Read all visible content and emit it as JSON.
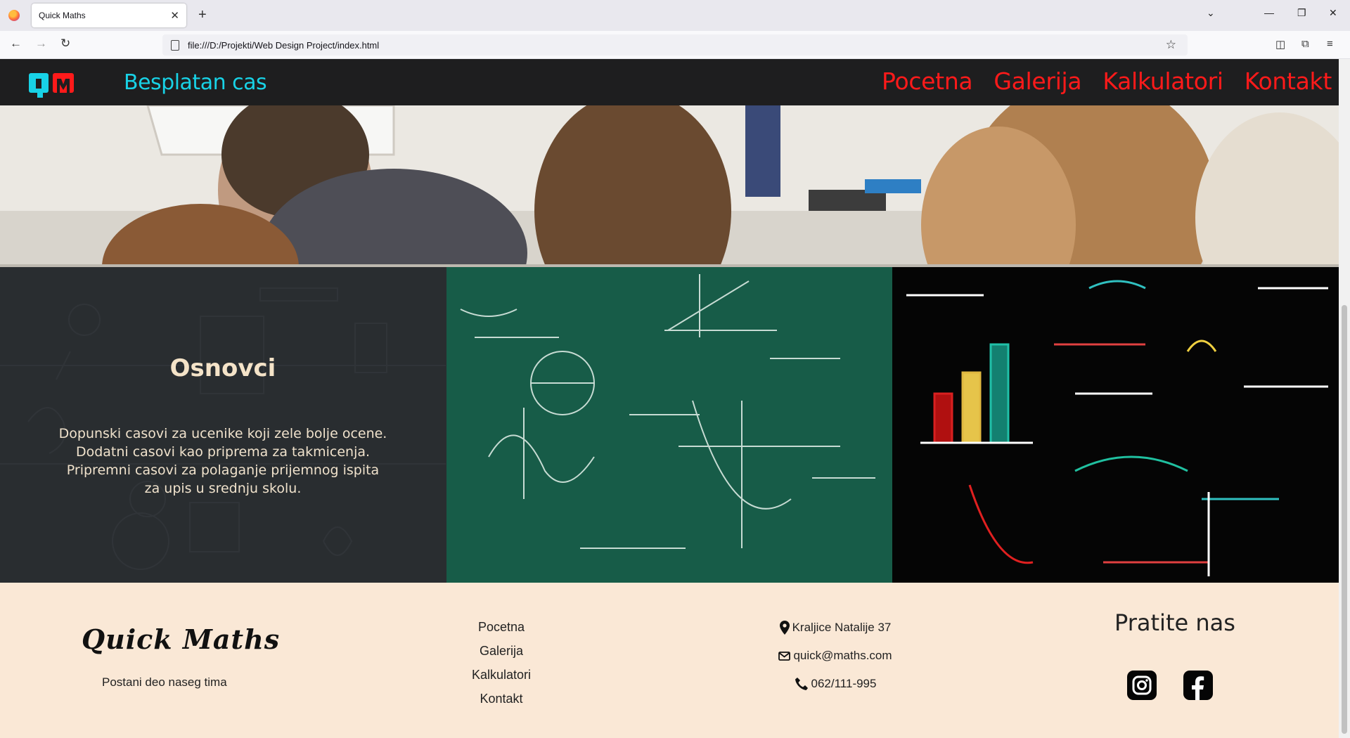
{
  "browser": {
    "tab_title": "Quick Maths",
    "tab_close": "✕",
    "new_tab": "+",
    "url": "file:///D:/Projekti/Web Design Project/index.html"
  },
  "header": {
    "cta": "Besplatan cas",
    "menu": [
      "Pocetna",
      "Galerija",
      "Kalkulatori",
      "Kontakt"
    ],
    "colors": {
      "background": "#1e1e1f",
      "cta": "#18d2e6",
      "menu": "#ff1a1a",
      "logo_left": "#18d2e6",
      "logo_right": "#ff1a1a"
    }
  },
  "card": {
    "title": "Osnovci",
    "lines": [
      "Dopunski casovi za ucenike koji zele bolje ocene.",
      "Dodatni casovi kao priprema za takmicenja.",
      "Pripremni casovi za polaganje prijemnog ispita",
      "za upis u srednju skolu."
    ]
  },
  "footer": {
    "brand": "Quick Maths",
    "tagline": "Postani deo naseg tima",
    "nav": [
      "Pocetna",
      "Galerija",
      "Kalkulatori",
      "Kontakt"
    ],
    "address": "Kraljice Natalije 37",
    "email": "quick@maths.com",
    "phone": "062/111-995",
    "follow_title": "Pratite nas",
    "social": [
      "instagram-icon",
      "facebook-icon"
    ],
    "background": "#fae8d6"
  }
}
